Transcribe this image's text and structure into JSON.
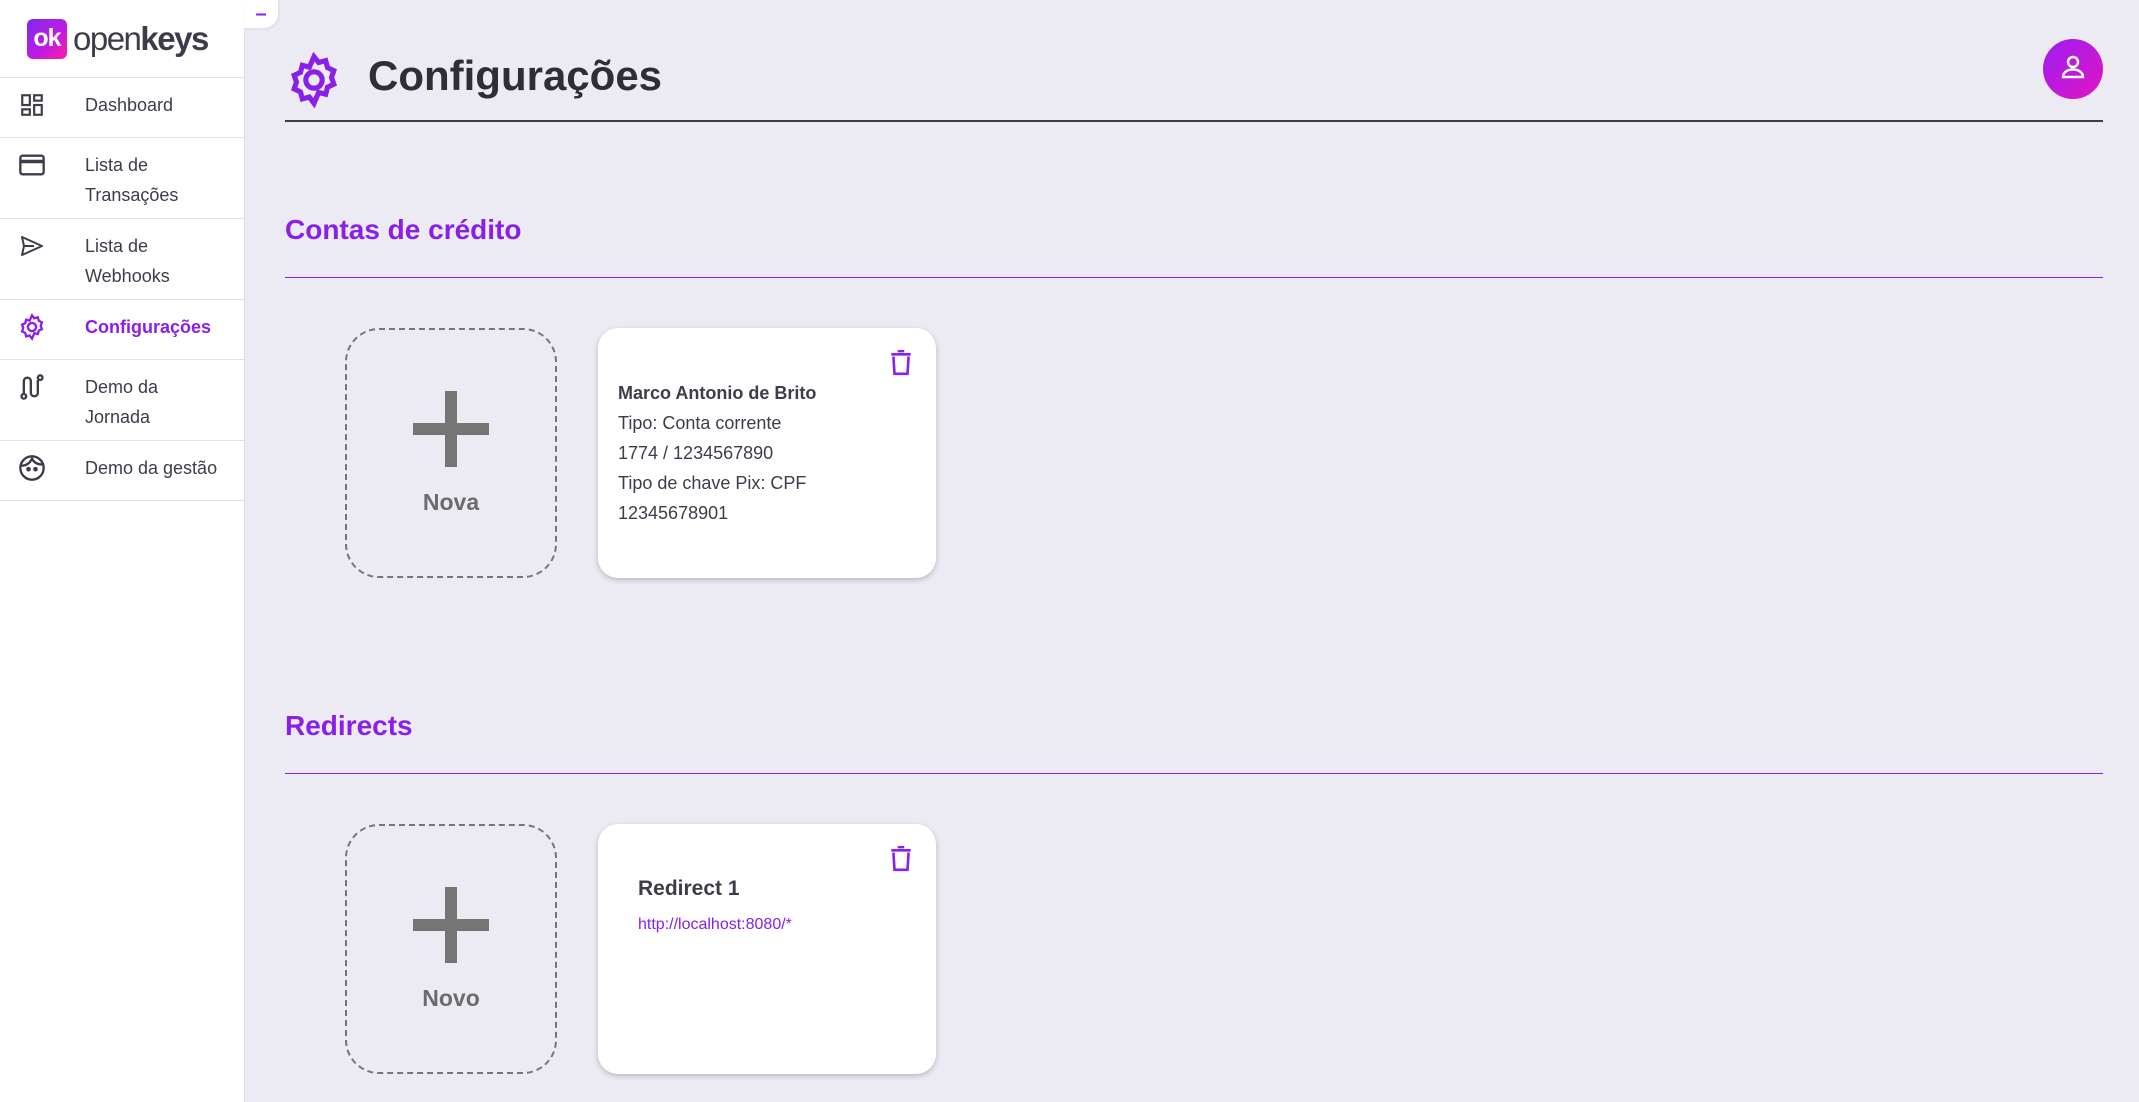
{
  "brand": {
    "mark": "ok",
    "name_light": "open",
    "name_bold": "keys",
    "accent": "#8a1fe8"
  },
  "sidebar": {
    "collapse_label": "–",
    "items": [
      {
        "label": "Dashboard",
        "icon": "dashboard-icon",
        "active": false
      },
      {
        "label": "Lista de Transações",
        "icon": "credit-card-icon",
        "active": false
      },
      {
        "label": "Lista de Webhooks",
        "icon": "send-icon",
        "active": false
      },
      {
        "label": "Configurações",
        "icon": "gear-icon",
        "active": true
      },
      {
        "label": "Demo da Jornada",
        "icon": "route-icon",
        "active": false
      },
      {
        "label": "Demo da gestão",
        "icon": "face-icon",
        "active": false
      }
    ]
  },
  "header": {
    "title": "Configurações",
    "icon": "gear-icon",
    "avatar_icon": "user-icon"
  },
  "credit_accounts": {
    "title": "Contas de crédito",
    "new_label": "Nova",
    "cards": [
      {
        "name": "Marco Antonio de Brito",
        "type": "Tipo: Conta corrente",
        "account": "1774 / 1234567890",
        "pix_type": "Tipo de chave Pix: CPF",
        "pix_key": "12345678901"
      }
    ]
  },
  "redirects": {
    "title": "Redirects",
    "new_label": "Novo",
    "cards": [
      {
        "name": "Redirect 1",
        "url": "http://localhost:8080/*"
      }
    ]
  }
}
